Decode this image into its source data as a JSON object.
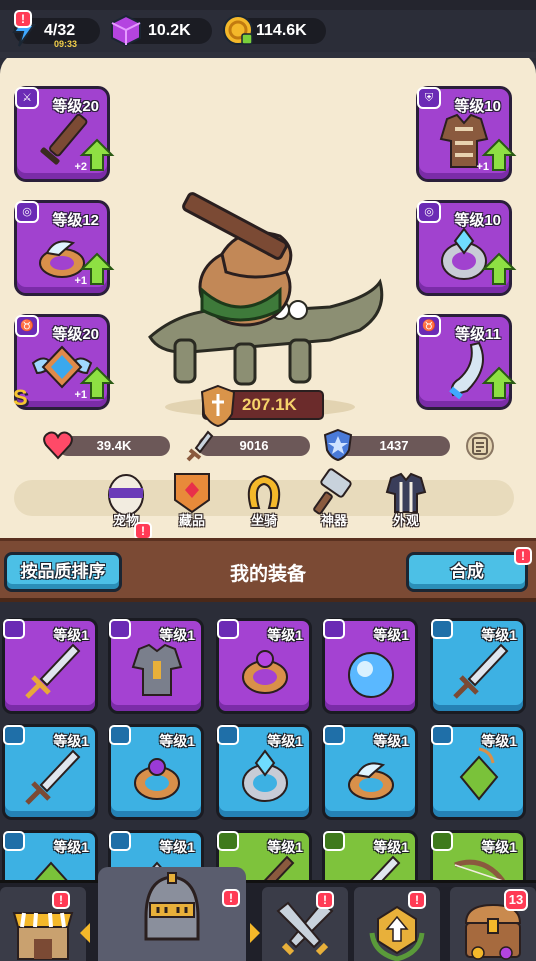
{
  "resources": {
    "energy": {
      "value": "4/32",
      "timer": "09:33"
    },
    "gems": {
      "value": "10.2K"
    },
    "coins": {
      "value": "114.6K"
    }
  },
  "equipped": [
    {
      "slot": "weapon",
      "level": "等级20",
      "plus": "+2",
      "item": "wooden-sword"
    },
    {
      "slot": "armor",
      "level": "等级10",
      "plus": "+1",
      "item": "leather-armor"
    },
    {
      "slot": "ring",
      "level": "等级12",
      "plus": "+1",
      "item": "wing-ring"
    },
    {
      "slot": "ring",
      "level": "等级10",
      "plus": "",
      "item": "crystal-ring"
    },
    {
      "slot": "necklace",
      "level": "等级20",
      "plus": "+1",
      "item": "winged-amulet",
      "grade": "S"
    },
    {
      "slot": "necklace",
      "level": "等级11",
      "plus": "",
      "item": "horn"
    }
  ],
  "power": "207.1K",
  "stats": {
    "hp": "39.4K",
    "attack": "9016",
    "defense": "1437"
  },
  "char_tabs": [
    "宠物",
    "藏品",
    "坐骑",
    "神器",
    "外观"
  ],
  "equipment_header": {
    "sort_button": "按品质排序",
    "title": "我的装备",
    "merge_button": "合成"
  },
  "inventory": [
    {
      "rarity": "purple",
      "level": "等级1",
      "item": "sword"
    },
    {
      "rarity": "purple",
      "level": "等级1",
      "item": "armor"
    },
    {
      "rarity": "purple",
      "level": "等级1",
      "item": "ring"
    },
    {
      "rarity": "purple",
      "level": "等级1",
      "item": "orb"
    },
    {
      "rarity": "blue",
      "level": "等级1",
      "item": "sword"
    },
    {
      "rarity": "blue",
      "level": "等级1",
      "item": "sword"
    },
    {
      "rarity": "blue",
      "level": "等级1",
      "item": "ring"
    },
    {
      "rarity": "blue",
      "level": "等级1",
      "item": "crystal-ring"
    },
    {
      "rarity": "blue",
      "level": "等级1",
      "item": "wing-ring"
    },
    {
      "rarity": "blue",
      "level": "等级1",
      "item": "amulet"
    },
    {
      "rarity": "blue",
      "level": "等级1",
      "item": "amulet"
    },
    {
      "rarity": "blue",
      "level": "等级1",
      "item": "amulet"
    },
    {
      "rarity": "green",
      "level": "等级1",
      "item": "sword"
    },
    {
      "rarity": "green",
      "level": "等级1",
      "item": "sword"
    },
    {
      "rarity": "green",
      "level": "等级1",
      "item": "bow"
    }
  ],
  "bottom_nav": {
    "active_label": "装备",
    "chest_badge": "13"
  }
}
